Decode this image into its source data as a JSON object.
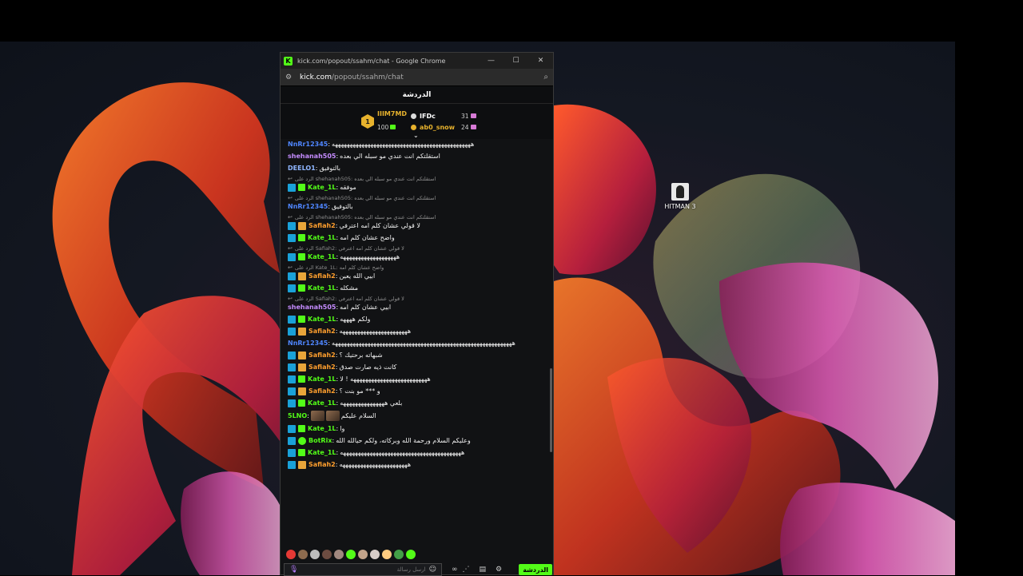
{
  "desktop": {
    "icon_label": "HITMAN 3"
  },
  "window": {
    "title": "kick.com/popout/ssahm/chat - Google Chrome",
    "url_host": "kick.com",
    "url_path": "/popout/ssahm/chat",
    "logo_glyph": "K",
    "minimize_glyph": "—",
    "maximize_glyph": "☐",
    "close_glyph": "✕"
  },
  "chat": {
    "header_title": "الدردشة",
    "leaderboard": {
      "rank_number": "1",
      "first": {
        "name": "IIIM7MD",
        "count": "100"
      },
      "second": {
        "name": "IFDc",
        "count": "31",
        "color": "#ffffff"
      },
      "third": {
        "name": "ab0_snow",
        "count": "24",
        "color": "#e7b22d"
      }
    },
    "messages": [
      {
        "type": "msg",
        "badges": [],
        "user": "NnRr12345",
        "color": "#4f86ff",
        "text": "هههههههههههههههههههههههههههههههههههههههههههههههه"
      },
      {
        "type": "msg",
        "badges": [],
        "user": "shehanah505",
        "color": "#c58cff",
        "text": "استقلتكم انت عندي مو سبله الي بعده"
      },
      {
        "type": "msg",
        "badges": [],
        "user": "DEELO1",
        "color": "#8fb6ff",
        "text": "بالتوفيق"
      },
      {
        "type": "reply",
        "text": "الرد على shehanah505: استقلتكم انت عندي مو سبله الي بعده"
      },
      {
        "type": "msg",
        "badges": [
          "og",
          "green"
        ],
        "user": "Kate_1L",
        "color": "#53fc18",
        "text": "موفقه"
      },
      {
        "type": "reply",
        "text": "الرد على shehanah505: استقلتكم انت عندي مو سبله الي بعده"
      },
      {
        "type": "msg",
        "badges": [],
        "user": "NnRr12345",
        "color": "#4f86ff",
        "text": "بالتوفيق"
      },
      {
        "type": "reply",
        "text": "الرد على shehanah505: استقلتكم انت عندي مو سبله الي بعده"
      },
      {
        "type": "msg",
        "badges": [
          "og",
          "crown"
        ],
        "user": "Safiah2",
        "color": "#ff9f2e",
        "text": "لا قولي عشان كلم امه اعترفي"
      },
      {
        "type": "msg",
        "badges": [
          "og",
          "green"
        ],
        "user": "Kate_1L",
        "color": "#53fc18",
        "text": "واضح عشان كلم امه"
      },
      {
        "type": "reply",
        "text": "الرد على Safiah2: لا قولي عشان كلم امه اعترفي"
      },
      {
        "type": "msg",
        "badges": [
          "og",
          "green"
        ],
        "user": "Kate_1L",
        "color": "#53fc18",
        "text": "هههههههههههههههههههه"
      },
      {
        "type": "reply",
        "text": "الرد على Kate_1L: واضح عشان كلم امه"
      },
      {
        "type": "msg",
        "badges": [
          "og",
          "crown"
        ],
        "user": "Safiah2",
        "color": "#ff9f2e",
        "text": "ابيي الله يعين"
      },
      {
        "type": "msg",
        "badges": [
          "og",
          "green"
        ],
        "user": "Kate_1L",
        "color": "#53fc18",
        "text": "مشكله"
      },
      {
        "type": "reply",
        "text": "الرد على Safiah2: لا قولي عشان كلم امه اعترفي"
      },
      {
        "type": "msg",
        "badges": [],
        "user": "shehanah505",
        "color": "#c58cff",
        "text": "ابيي عشان كلم امه"
      },
      {
        "type": "msg",
        "badges": [
          "og",
          "green"
        ],
        "user": "Kate_1L",
        "color": "#53fc18",
        "text": "ولكم ههههه"
      },
      {
        "type": "msg",
        "badges": [
          "og",
          "crown"
        ],
        "user": "Safiah2",
        "color": "#ff9f2e",
        "text": "هههههههههههههههههههههههه"
      },
      {
        "type": "msg",
        "badges": [],
        "user": "NnRr12345",
        "color": "#4f86ff",
        "text": "هههههههههههههههههههههههههههههههههههههههههههههههههههههههههههههه"
      },
      {
        "type": "msg",
        "badges": [
          "og",
          "crown"
        ],
        "user": "Safiah2",
        "color": "#ff9f2e",
        "text": "شبهاته برحتيك ؟"
      },
      {
        "type": "msg",
        "badges": [
          "og",
          "crown"
        ],
        "user": "Safiah2",
        "color": "#ff9f2e",
        "text": "كانت ذيه صارت صدق"
      },
      {
        "type": "msg",
        "badges": [
          "og",
          "green"
        ],
        "user": "Kate_1L",
        "color": "#53fc18",
        "text": "ههههههههههههههههههههههههههه ! لا"
      },
      {
        "type": "msg",
        "badges": [
          "og",
          "crown"
        ],
        "user": "Safiah2",
        "color": "#ff9f2e",
        "text": "و *** مو بنت ؟"
      },
      {
        "type": "msg",
        "badges": [
          "og",
          "green"
        ],
        "user": "Kate_1L",
        "color": "#53fc18",
        "text": "بلعي هههههههههههههههه"
      },
      {
        "type": "msg",
        "badges": [],
        "user": "5LNO",
        "color": "#53fc18",
        "text": "السلام عليكم",
        "emotes": 2
      },
      {
        "type": "msg",
        "badges": [
          "og",
          "green"
        ],
        "user": "Kate_1L",
        "color": "#53fc18",
        "text": "وا"
      },
      {
        "type": "msg",
        "badges": [
          "og",
          "bot"
        ],
        "user": "BotRix",
        "color": "#53fc18",
        "text": "وعليكم السلام ورحمة الله وبركاته، ولكم حيالله الله"
      },
      {
        "type": "msg",
        "badges": [
          "og",
          "green"
        ],
        "user": "Kate_1L",
        "color": "#53fc18",
        "text": "هههههههههههههههههههههههههههههههههههههههههه"
      },
      {
        "type": "msg",
        "badges": [
          "og",
          "crown"
        ],
        "user": "Safiah2",
        "color": "#ff9f2e",
        "text": "هههههههههههههههههههههههه"
      }
    ],
    "quick_emotes": [
      "#e53935",
      "#8d6b4e",
      "#bdbdbd",
      "#6d4c41",
      "#a1887f",
      "#53fc18",
      "#c2a38a",
      "#d7ccc8",
      "#ffcc80",
      "#43a047",
      "#53fc18"
    ],
    "input_placeholder": "ارسل رسالة",
    "mic_glyph": "🎙",
    "emoji_glyph": "☺",
    "send_label": "الدردشة",
    "reply_arrow": "↩",
    "collapse_glyph": "⌄"
  },
  "colors": {
    "accent": "#53fc18",
    "gold": "#e7b22d"
  }
}
